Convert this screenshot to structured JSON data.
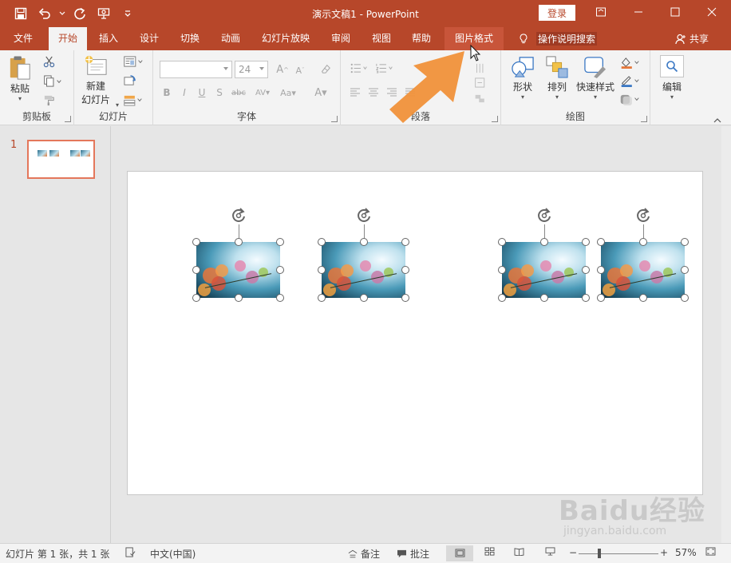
{
  "window": {
    "title": "演示文稿1 - PowerPoint",
    "login_label": "登录"
  },
  "qat": {
    "icons": [
      "save-icon",
      "undo-icon",
      "redo-icon",
      "present-icon",
      "customize-icon"
    ]
  },
  "tabs": [
    {
      "label": "文件",
      "name": "tab-file"
    },
    {
      "label": "开始",
      "name": "tab-home"
    },
    {
      "label": "插入",
      "name": "tab-insert"
    },
    {
      "label": "设计",
      "name": "tab-design"
    },
    {
      "label": "切换",
      "name": "tab-transitions"
    },
    {
      "label": "动画",
      "name": "tab-animations"
    },
    {
      "label": "幻灯片放映",
      "name": "tab-slideshow"
    },
    {
      "label": "审阅",
      "name": "tab-review"
    },
    {
      "label": "视图",
      "name": "tab-view"
    },
    {
      "label": "帮助",
      "name": "tab-help"
    },
    {
      "label": "图片格式",
      "name": "tab-picture-format"
    }
  ],
  "tell_me": "操作说明搜索",
  "share_label": "共享",
  "ribbon": {
    "clipboard": {
      "label": "剪贴板",
      "paste": "粘贴"
    },
    "slides": {
      "label": "幻灯片",
      "new_slide_1": "新建",
      "new_slide_2": "幻灯片"
    },
    "font": {
      "label": "字体",
      "font_name": "",
      "font_size": "24"
    },
    "paragraph": {
      "label": "段落"
    },
    "drawing": {
      "label": "绘图",
      "shapes": "形状",
      "arrange": "排列",
      "quick_styles": "快速样式"
    },
    "editing": {
      "label": "编辑"
    }
  },
  "thumbnails": {
    "slide_number": "1"
  },
  "statusbar": {
    "slide_info": "幻灯片 第 1 张，共 1 张",
    "language": "中文(中国)",
    "notes": "备注",
    "comments": "批注",
    "zoom": "57%",
    "zoom_level": 0.57
  },
  "watermark": {
    "brand": "Baidu经验",
    "url": "jingyan.baidu.com"
  },
  "colors": {
    "accent": "#b7472a",
    "highlight_arrow": "#f0913a"
  }
}
